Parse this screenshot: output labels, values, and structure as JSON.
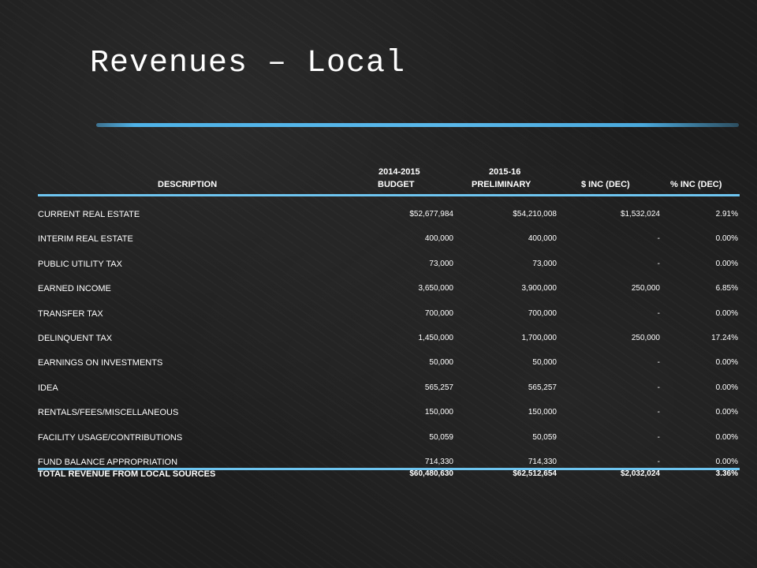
{
  "slide": {
    "title": "Revenues – Local"
  },
  "table": {
    "headers": {
      "description": "DESCRIPTION",
      "budget_year": "2014-2015",
      "budget": "BUDGET",
      "prelim_year": "2015-16",
      "preliminary": "PRELIMINARY",
      "inc_dollar": "$ INC (DEC)",
      "inc_pct": "% INC (DEC)"
    },
    "rows": [
      {
        "description": "CURRENT REAL ESTATE",
        "budget": "$52,677,984",
        "preliminary": "$54,210,008",
        "inc_dollar": "$1,532,024",
        "inc_pct": "2.91%"
      },
      {
        "description": "INTERIM REAL ESTATE",
        "budget": "400,000",
        "preliminary": "400,000",
        "inc_dollar": "-",
        "inc_pct": "0.00%"
      },
      {
        "description": "PUBLIC UTILITY TAX",
        "budget": "73,000",
        "preliminary": "73,000",
        "inc_dollar": "-",
        "inc_pct": "0.00%"
      },
      {
        "description": "EARNED INCOME",
        "budget": "3,650,000",
        "preliminary": "3,900,000",
        "inc_dollar": "250,000",
        "inc_pct": "6.85%"
      },
      {
        "description": "TRANSFER TAX",
        "budget": "700,000",
        "preliminary": "700,000",
        "inc_dollar": "-",
        "inc_pct": "0.00%"
      },
      {
        "description": "DELINQUENT TAX",
        "budget": "1,450,000",
        "preliminary": "1,700,000",
        "inc_dollar": "250,000",
        "inc_pct": "17.24%"
      },
      {
        "description": "EARNINGS ON INVESTMENTS",
        "budget": "50,000",
        "preliminary": "50,000",
        "inc_dollar": "-",
        "inc_pct": "0.00%"
      },
      {
        "description": "IDEA",
        "budget": "565,257",
        "preliminary": "565,257",
        "inc_dollar": "-",
        "inc_pct": "0.00%"
      },
      {
        "description": "RENTALS/FEES/MISCELLANEOUS",
        "budget": "150,000",
        "preliminary": "150,000",
        "inc_dollar": "-",
        "inc_pct": "0.00%"
      },
      {
        "description": "FACILITY USAGE/CONTRIBUTIONS",
        "budget": "50,059",
        "preliminary": "50,059",
        "inc_dollar": "-",
        "inc_pct": "0.00%"
      },
      {
        "description": "FUND BALANCE APPROPRIATION",
        "budget": "714,330",
        "preliminary": "714,330",
        "inc_dollar": "-",
        "inc_pct": "0.00%"
      }
    ],
    "total": {
      "description": "TOTAL REVENUE FROM LOCAL SOURCES",
      "budget": "$60,480,630",
      "preliminary": "$62,512,654",
      "inc_dollar": "$2,032,024",
      "inc_pct": "3.36%"
    }
  },
  "colors": {
    "background": "#1d1d1d",
    "accent": "#4fb3e8",
    "text": "#ffffff"
  }
}
